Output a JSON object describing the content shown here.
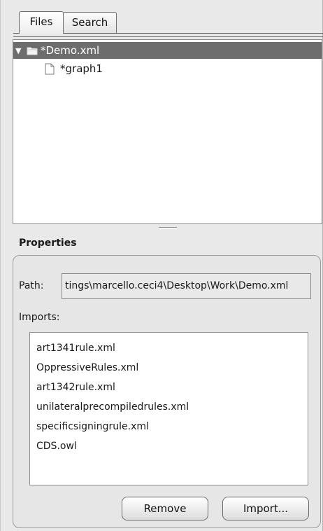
{
  "tabs": [
    {
      "label": "Files",
      "active": true
    },
    {
      "label": "Search",
      "active": false
    }
  ],
  "tree": {
    "root": {
      "label": "*Demo.xml",
      "icon": "folder-icon",
      "expanded": true,
      "selected": true
    },
    "children": [
      {
        "label": "*graph1",
        "icon": "document-icon"
      }
    ]
  },
  "properties": {
    "title": "Properties",
    "path_label": "Path:",
    "path_value": "tings\\marcello.ceci4\\Desktop\\Work\\Demo.xml",
    "imports_label": "Imports:",
    "imports": [
      "art1341rule.xml",
      "OppressiveRules.xml",
      "art1342rule.xml",
      "unilateralprecompiledrules.xml",
      "specificsigningrule.xml",
      "CDS.owl"
    ],
    "buttons": {
      "remove_label": "Remove",
      "import_label": "Import..."
    }
  },
  "colors": {
    "selection": "#6d6d6d",
    "panel_bg": "#e9e9e9",
    "list_bg": "#ffffff"
  }
}
